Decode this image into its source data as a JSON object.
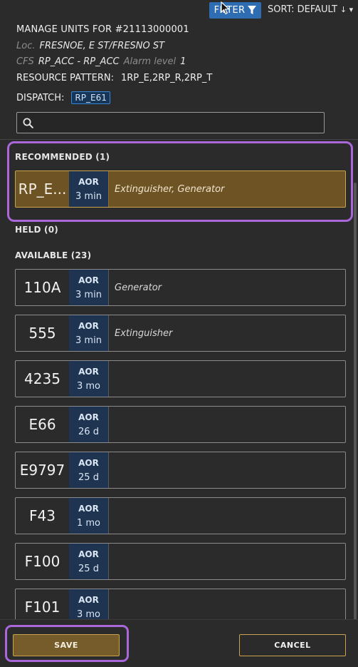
{
  "topbar": {
    "filter_label": "FILTER",
    "sort_label": "SORT: DEFAULT",
    "sort_caret": "↓ ▾"
  },
  "header": {
    "title": "MANAGE UNITS FOR #21113000001",
    "loc_label": "Loc.",
    "loc_value": "FRESNOE, E ST/FRESNO ST",
    "cfs_label": "CFS",
    "cfs_value": "RP_ACC - RP_ACC",
    "alarm_label": "Alarm level",
    "alarm_value": "1",
    "resource_label": "RESOURCE PATTERN:",
    "resource_value": "1RP_E,2RP_R,2RP_T",
    "dispatch_label": "DISPATCH:",
    "dispatch_badge": "RP_E61"
  },
  "search": {
    "value": "",
    "placeholder": ""
  },
  "sections": {
    "recommended": "RECOMMENDED (1)",
    "held": "HELD (0)",
    "available": "AVAILABLE (23)"
  },
  "recommended": [
    {
      "name": "RP_E...",
      "aor": "AOR",
      "time": "3 min",
      "caps": "Extinguisher, Generator"
    }
  ],
  "available": [
    {
      "name": "110A",
      "aor": "AOR",
      "time": "3 min",
      "caps": "Generator"
    },
    {
      "name": "555",
      "aor": "AOR",
      "time": "3 min",
      "caps": "Extinguisher"
    },
    {
      "name": "4235",
      "aor": "AOR",
      "time": "3 mo",
      "caps": ""
    },
    {
      "name": "E66",
      "aor": "AOR",
      "time": "26 d",
      "caps": ""
    },
    {
      "name": "E9797",
      "aor": "AOR",
      "time": "25 d",
      "caps": ""
    },
    {
      "name": "F43",
      "aor": "AOR",
      "time": "1 mo",
      "caps": ""
    },
    {
      "name": "F100",
      "aor": "AOR",
      "time": "25 d",
      "caps": ""
    },
    {
      "name": "F101",
      "aor": "AOR",
      "time": "3 mo",
      "caps": ""
    }
  ],
  "footer": {
    "save_label": "SAVE",
    "cancel_label": "CANCEL"
  },
  "colors": {
    "accent_blue": "#2f6db3",
    "recommended_gold": "#6e5425",
    "highlight_purple": "#a967d9"
  }
}
